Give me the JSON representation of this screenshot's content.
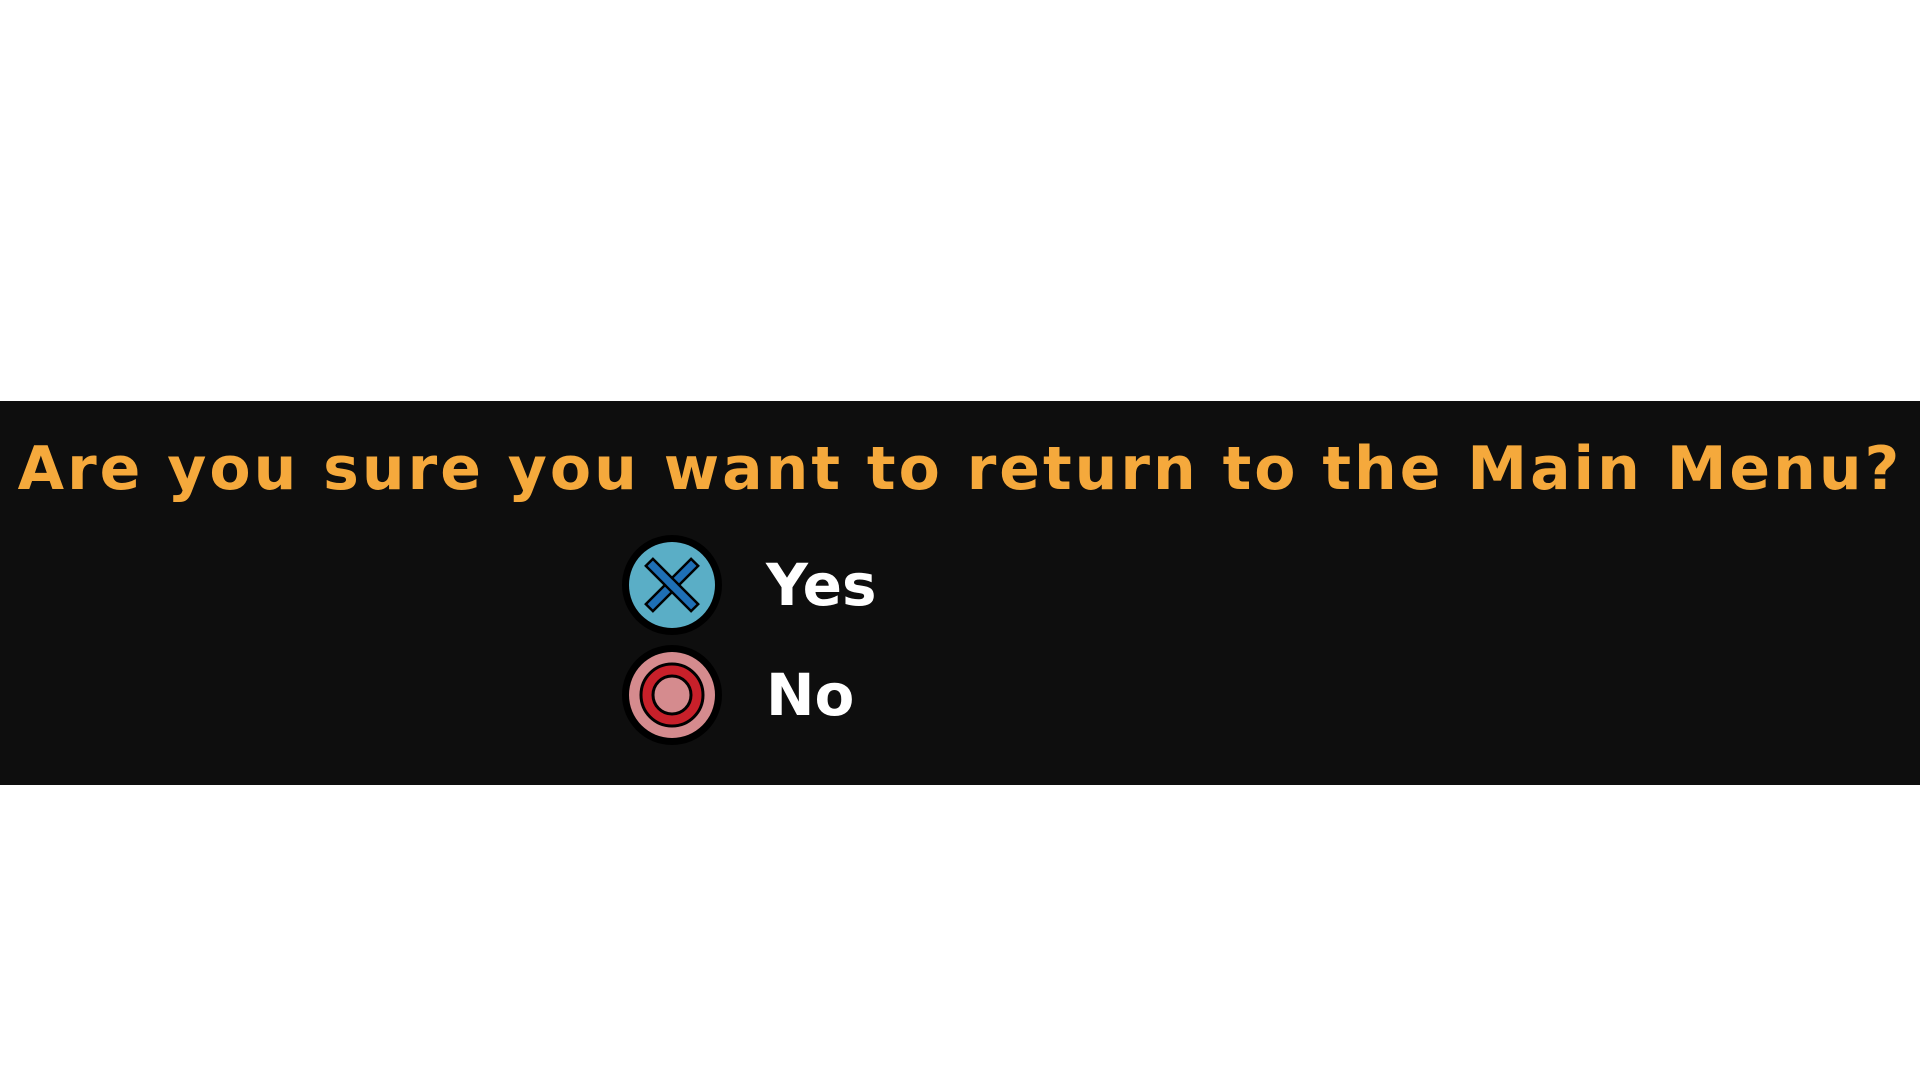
{
  "dialog": {
    "question": "Are you sure you want to return to the Main Menu?",
    "options": [
      {
        "label": "Yes",
        "icon": "cross-button-icon",
        "color": "#5aaec6",
        "accent": "#1e6fb5"
      },
      {
        "label": "No",
        "icon": "circle-button-icon",
        "color": "#d58b8e",
        "accent": "#c8202a"
      }
    ]
  },
  "colors": {
    "band": "#0e0e0e",
    "question_text": "#f5a93c",
    "option_text": "#ffffff",
    "background": "#ffffff"
  }
}
